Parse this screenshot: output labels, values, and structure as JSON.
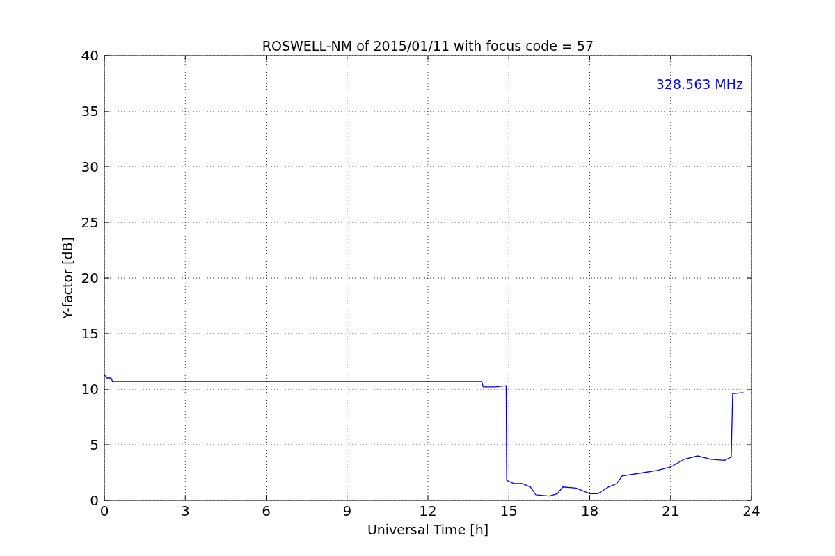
{
  "chart": {
    "chart_data": {
      "type": "line",
      "title": "ROSWELL-NM of 2015/01/11 with focus code = 57",
      "xlabel": "Universal Time [h]",
      "ylabel": "Y-factor [dB]",
      "x": [
        0,
        0.1,
        0.25,
        0.3,
        14.0,
        14.05,
        14.5,
        14.9,
        14.92,
        15.2,
        15.5,
        15.8,
        16.0,
        16.5,
        16.8,
        17.0,
        17.5,
        18.0,
        18.3,
        18.7,
        19.0,
        19.2,
        20.0,
        20.5,
        21.0,
        21.5,
        22.0,
        22.5,
        23.0,
        23.25,
        23.3,
        23.7
      ],
      "series": [
        {
          "name": "328.563 MHz",
          "color": "#0000ff",
          "values": [
            11.3,
            11.0,
            11.0,
            10.7,
            10.7,
            10.2,
            10.2,
            10.3,
            1.8,
            1.5,
            1.5,
            1.2,
            0.5,
            0.4,
            0.6,
            1.2,
            1.1,
            0.6,
            0.6,
            1.2,
            1.5,
            2.2,
            2.5,
            2.7,
            3.0,
            3.7,
            4.0,
            3.7,
            3.6,
            3.9,
            9.6,
            9.7
          ]
        }
      ],
      "xlim": [
        0,
        24
      ],
      "ylim": [
        0,
        40
      ],
      "xticks": [
        0,
        3,
        6,
        9,
        12,
        15,
        18,
        21,
        24
      ],
      "yticks": [
        0,
        5,
        10,
        15,
        20,
        25,
        30,
        35,
        40
      ],
      "grid": true
    }
  }
}
